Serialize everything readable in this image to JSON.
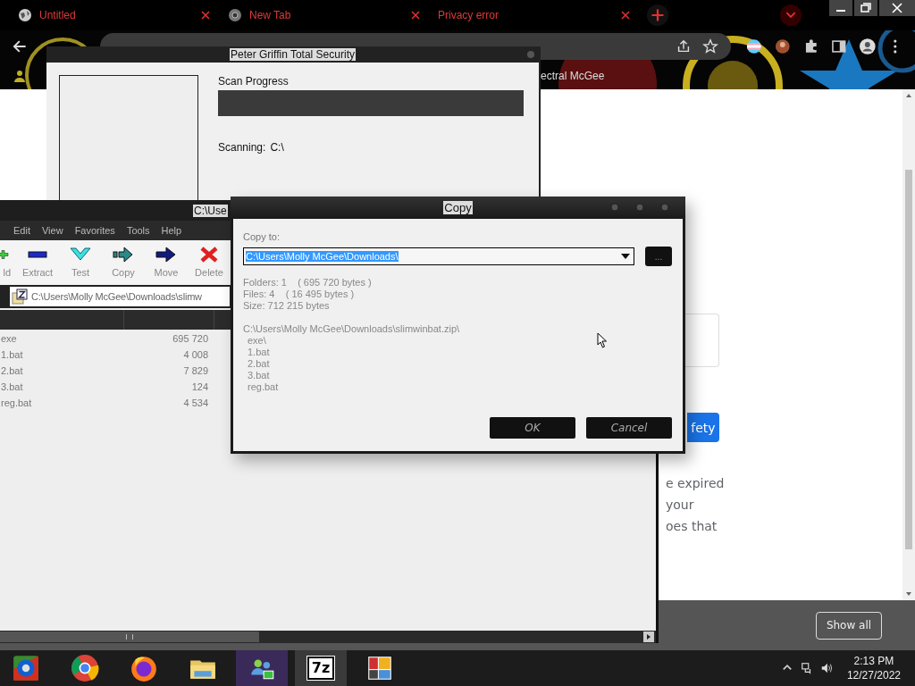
{
  "browser": {
    "tabs": [
      {
        "title": "Untitled"
      },
      {
        "title": "New Tab"
      },
      {
        "title": "Privacy error"
      }
    ],
    "bookmark": "ectral McGee",
    "page": {
      "lines": [
        "e expired",
        "your",
        "oes that"
      ],
      "button": "fety"
    },
    "downloads_button": "Show all"
  },
  "security_window": {
    "title": "Peter Griffin Total Security",
    "progress_label": "Scan Progress",
    "progress": {
      "level": 0
    },
    "status_label": "Scanning:",
    "status_value": "C:\\"
  },
  "zip_window": {
    "title": "C:\\Use",
    "menu": [
      "Edit",
      "View",
      "Favorites",
      "Tools",
      "Help"
    ],
    "toolbar": [
      {
        "kind": "add",
        "label": "ld"
      },
      {
        "kind": "extract",
        "label": "Extract"
      },
      {
        "kind": "test",
        "label": "Test"
      },
      {
        "kind": "copy",
        "label": "Copy"
      },
      {
        "kind": "move",
        "label": "Move"
      },
      {
        "kind": "delete",
        "label": "Delete"
      }
    ],
    "path": "C:\\Users\\Molly McGee\\Downloads\\slimw",
    "rows": [
      {
        "name": "exe",
        "size": "695 720"
      },
      {
        "name": "1.bat",
        "size": "4 008"
      },
      {
        "name": "2.bat",
        "size": "7 829"
      },
      {
        "name": "3.bat",
        "size": "124"
      },
      {
        "name": "reg.bat",
        "size": "4 534"
      }
    ]
  },
  "copy_dialog": {
    "title": "Copy",
    "label": "Copy to:",
    "field": {
      "value": "C:\\Users\\Molly McGee\\Downloads\\",
      "text_selected": true
    },
    "browse": "...",
    "info": [
      "Folders: 1    ( 695 720 bytes )",
      "Files: 4    ( 16 495 bytes )",
      "Size: 712 215 bytes"
    ],
    "source": "C:\\Users\\Molly McGee\\Downloads\\slimwinbat.zip\\",
    "items": [
      "exe\\",
      "1.bat",
      "2.bat",
      "3.bat",
      "reg.bat"
    ],
    "buttons": [
      "OK",
      "Cancel"
    ]
  },
  "taskbar": {
    "apps": [
      {
        "kind": "media",
        "selected": false
      },
      {
        "kind": "chrome",
        "selected": false
      },
      {
        "kind": "firefox",
        "selected": false
      },
      {
        "kind": "explorer",
        "selected": false
      },
      {
        "kind": "messenger",
        "selected": false
      },
      {
        "kind": "archiver",
        "label": "7z",
        "selected": true
      },
      {
        "kind": "tiles",
        "selected": false
      }
    ],
    "time": "2:13 PM",
    "date": "12/27/2022"
  }
}
